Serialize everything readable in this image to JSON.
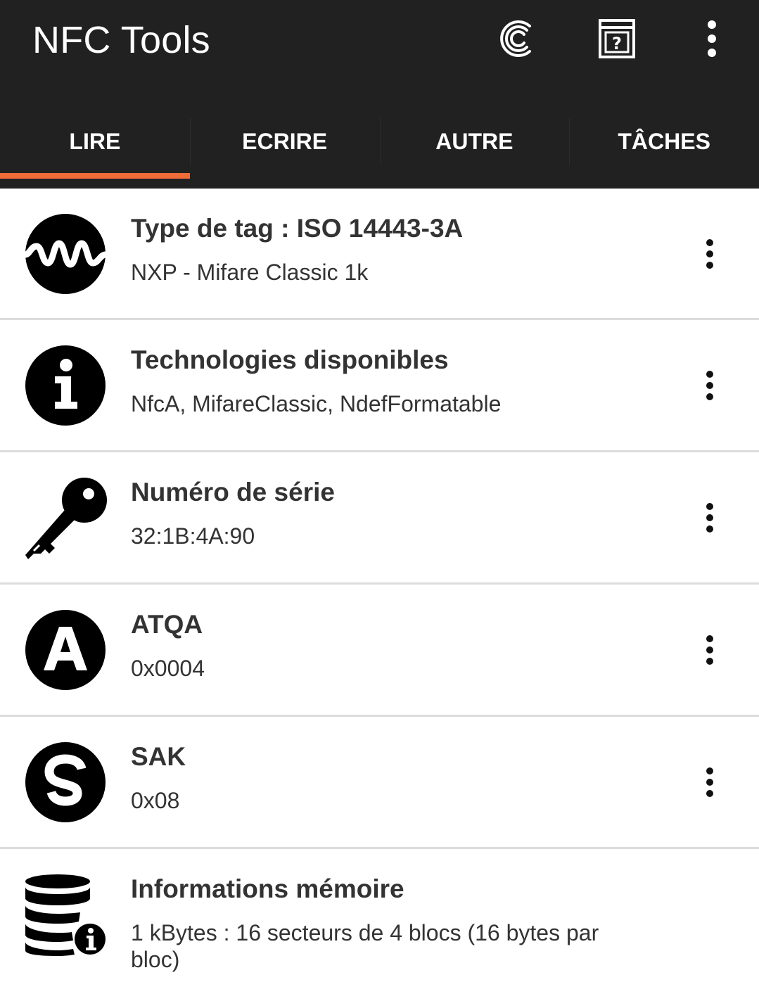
{
  "app": {
    "title": "NFC Tools"
  },
  "actions": [
    "pro-icon",
    "help-icon",
    "overflow-menu-icon"
  ],
  "tabs": [
    {
      "label": "LIRE",
      "active": true
    },
    {
      "label": "ECRIRE",
      "active": false
    },
    {
      "label": "AUTRE",
      "active": false
    },
    {
      "label": "TÂCHES",
      "active": false
    }
  ],
  "items": [
    {
      "icon": "waveform-icon",
      "title": "Type de tag : ISO 14443-3A",
      "value": "NXP - Mifare Classic 1k"
    },
    {
      "icon": "info-icon",
      "title": "Technologies disponibles",
      "value": "NfcA, MifareClassic, NdefFormatable"
    },
    {
      "icon": "key-icon",
      "title": "Numéro de série",
      "value": "32:1B:4A:90"
    },
    {
      "icon": "letter-a-icon",
      "title": "ATQA",
      "value": "0x0004"
    },
    {
      "icon": "letter-s-icon",
      "title": "SAK",
      "value": "0x08"
    },
    {
      "icon": "database-info-icon",
      "title": "Informations mémoire",
      "value": "1 kBytes : 16 secteurs de 4 blocs (16 bytes par bloc)"
    }
  ],
  "colors": {
    "appbar": "#212121",
    "accent": "#ef6b38",
    "text": "#333333",
    "divider": "#dcdcdc"
  }
}
